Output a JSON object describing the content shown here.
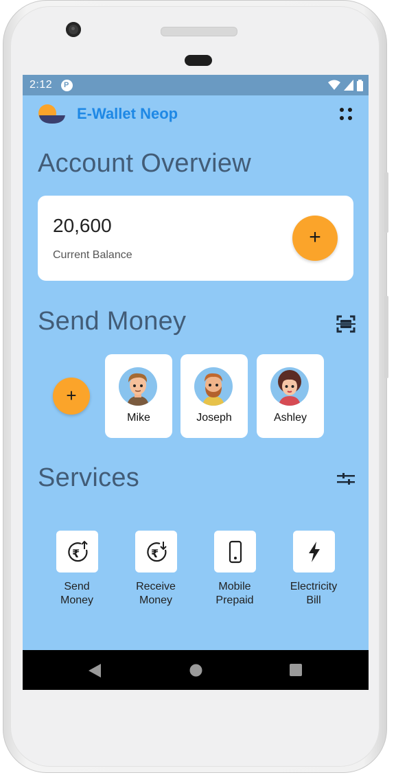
{
  "status_bar": {
    "time": "2:12",
    "badge_letter": "P"
  },
  "app_bar": {
    "title": "E-Wallet Neop",
    "logo_icon": "half-circle-logo",
    "menu_icon": "four-dots-icon"
  },
  "account": {
    "heading": "Account Overview",
    "balance_value": "20,600",
    "balance_label": "Current Balance",
    "add_icon": "+"
  },
  "send_money": {
    "heading": "Send Money",
    "add_icon": "+",
    "scan_icon": "scan-icon",
    "contacts": [
      {
        "name": "Mike"
      },
      {
        "name": "Joseph"
      },
      {
        "name": "Ashley"
      }
    ]
  },
  "services": {
    "heading": "Services",
    "filter_icon": "tune-icon",
    "items": [
      {
        "line1": "Send",
        "line2": "Money",
        "icon": "rupee-send-icon"
      },
      {
        "line1": "Receive",
        "line2": "Money",
        "icon": "rupee-receive-icon"
      },
      {
        "line1": "Mobile",
        "line2": "Prepaid",
        "icon": "mobile-icon"
      },
      {
        "line1": "Electricity",
        "line2": "Bill",
        "icon": "bolt-icon"
      }
    ]
  },
  "colors": {
    "screen_bg": "#90c9f6",
    "accent": "#fba42a",
    "title_blue": "#1e88e5",
    "heading": "#425c77"
  }
}
